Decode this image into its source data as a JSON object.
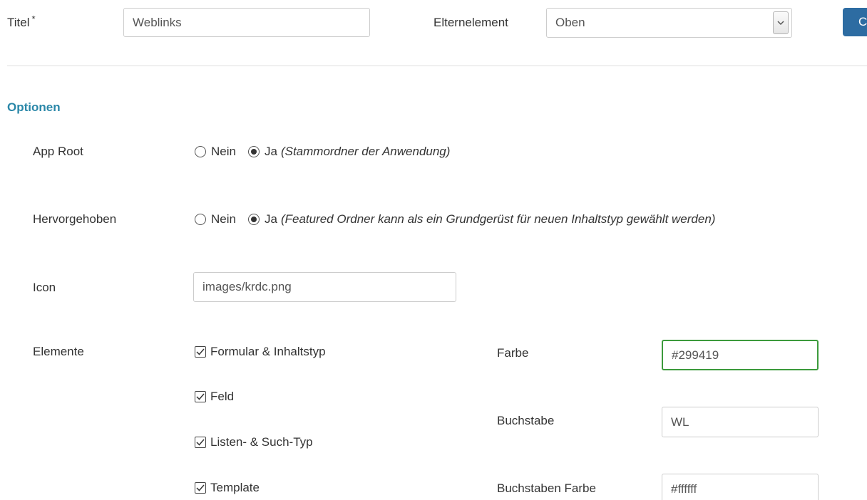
{
  "header": {
    "title_label": "Titel",
    "required_mark": "*",
    "title_value": "Weblinks",
    "parent_label": "Elternelement",
    "parent_value": "Oben",
    "action_button_label": "C"
  },
  "options": {
    "section_title": "Optionen",
    "app_root": {
      "label": "App Root",
      "option_no": "Nein",
      "option_yes": "Ja",
      "hint": "(Stammordner der Anwendung)",
      "selected": "Ja"
    },
    "featured": {
      "label": "Hervorgehoben",
      "option_no": "Nein",
      "option_yes": "Ja",
      "hint": "(Featured Ordner kann als ein Grundgerüst für neuen Inhaltstyp gewählt werden)",
      "selected": "Ja"
    },
    "icon": {
      "label": "Icon",
      "value": "images/krdc.png"
    },
    "elements": {
      "label": "Elemente",
      "items": [
        {
          "label": "Formular & Inhaltstyp",
          "checked": true
        },
        {
          "label": "Feld",
          "checked": true
        },
        {
          "label": "Listen- & Such-Typ",
          "checked": true
        },
        {
          "label": "Template",
          "checked": true
        }
      ]
    },
    "color": {
      "label": "Farbe",
      "value": "#299419"
    },
    "letter": {
      "label": "Buchstabe",
      "value": "WL"
    },
    "letter_color": {
      "label": "Buchstaben Farbe",
      "value": "#ffffff"
    }
  },
  "colors": {
    "section_title": "#2a87a8",
    "primary_button": "#2d6ca2",
    "valid_border": "#3c9a3c"
  }
}
